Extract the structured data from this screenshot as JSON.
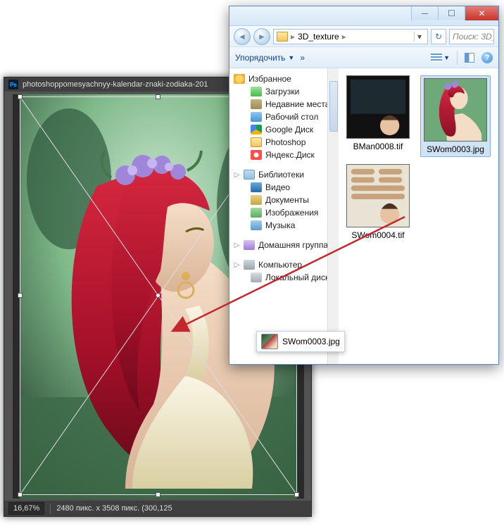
{
  "photoshop": {
    "logo": "Ps",
    "title": "photoshoppomesyachnyy-kalendar-znaki-zodiaka-201",
    "title_zoom": "16,67%",
    "status_zoom": "16,67%",
    "status_dims": "2480 пикс. x 3508 пикс. (300,125"
  },
  "explorer": {
    "breadcrumb": {
      "folder": "3D_texture"
    },
    "search_placeholder": "Поиск: 3D_",
    "toolbar": {
      "organize": "Упорядочить",
      "more": "»"
    },
    "tree": {
      "favorites": {
        "label": "Избранное",
        "items": [
          {
            "icon": "dl",
            "label": "Загрузки"
          },
          {
            "icon": "recent",
            "label": "Недавние места"
          },
          {
            "icon": "desk",
            "label": "Рабочий стол"
          },
          {
            "icon": "gd",
            "label": "Google Диск"
          },
          {
            "icon": "folder",
            "label": "Photoshop"
          },
          {
            "icon": "yd",
            "label": "Яндекс.Диск"
          }
        ]
      },
      "libraries": {
        "label": "Библиотеки",
        "items": [
          {
            "icon": "vid",
            "label": "Видео"
          },
          {
            "icon": "doc",
            "label": "Документы"
          },
          {
            "icon": "img",
            "label": "Изображения"
          },
          {
            "icon": "mus",
            "label": "Музыка"
          }
        ]
      },
      "homegroup": {
        "label": "Домашняя группа"
      },
      "computer": {
        "label": "Компьютер",
        "items": [
          {
            "icon": "disk",
            "label": "Локальный диск"
          }
        ]
      }
    },
    "files": [
      {
        "id": "f0",
        "label": "BMan0008.tif",
        "selected": false
      },
      {
        "id": "f1",
        "label": "SWom0003.jpg",
        "selected": true
      },
      {
        "id": "f2",
        "label": "SWom0004.tif",
        "selected": false
      }
    ],
    "drag_filename": "SWom0003.jpg"
  }
}
